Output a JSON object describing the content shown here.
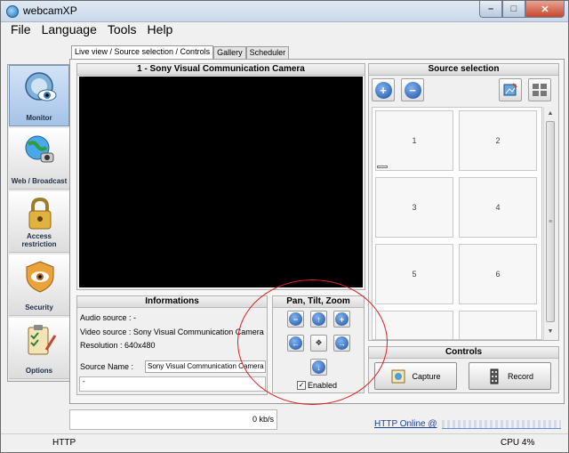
{
  "window": {
    "title": "webcamXP"
  },
  "menu": [
    "File",
    "Language",
    "Tools",
    "Help"
  ],
  "nav": [
    {
      "label": "Monitor",
      "icon": "monitor-eye-icon",
      "active": true
    },
    {
      "label": "Web / Broadcast",
      "icon": "globe-broadcast-icon",
      "active": false
    },
    {
      "label": "Access restriction",
      "icon": "padlock-icon",
      "active": false
    },
    {
      "label": "Security",
      "icon": "shield-eye-icon",
      "active": false
    },
    {
      "label": "Options",
      "icon": "clipboard-checklist-icon",
      "active": false
    }
  ],
  "tabs": [
    {
      "label": "Live view / Source selection / Controls",
      "active": true
    },
    {
      "label": "Gallery",
      "active": false
    },
    {
      "label": "Scheduler",
      "active": false
    }
  ],
  "video": {
    "title": "1 - Sony Visual Communication Camera"
  },
  "info": {
    "title": "Informations",
    "audio": "Audio source : -",
    "video": "Video source : Sony Visual Communication Camera",
    "resolution": "Resolution : 640x480",
    "source_name_label": "Source Name :",
    "source_name_value": "Sony Visual Communication Camera",
    "extra_value": "-"
  },
  "ptz": {
    "title": "Pan, Tilt, Zoom",
    "enabled_label": "Enabled",
    "enabled": true
  },
  "source_selection": {
    "title": "Source selection",
    "cells": [
      "1",
      "2",
      "3",
      "4",
      "5",
      "6",
      "",
      ""
    ]
  },
  "controls": {
    "title": "Controls",
    "capture_label": "Capture",
    "record_label": "Record"
  },
  "bandwidth": "0 kb/s",
  "http_online": "HTTP Online @",
  "status": {
    "left": "HTTP",
    "cpu": "CPU 4%"
  },
  "colors": {
    "accent_blue": "#1c4f9f",
    "highlight_circle": "#e02020"
  }
}
